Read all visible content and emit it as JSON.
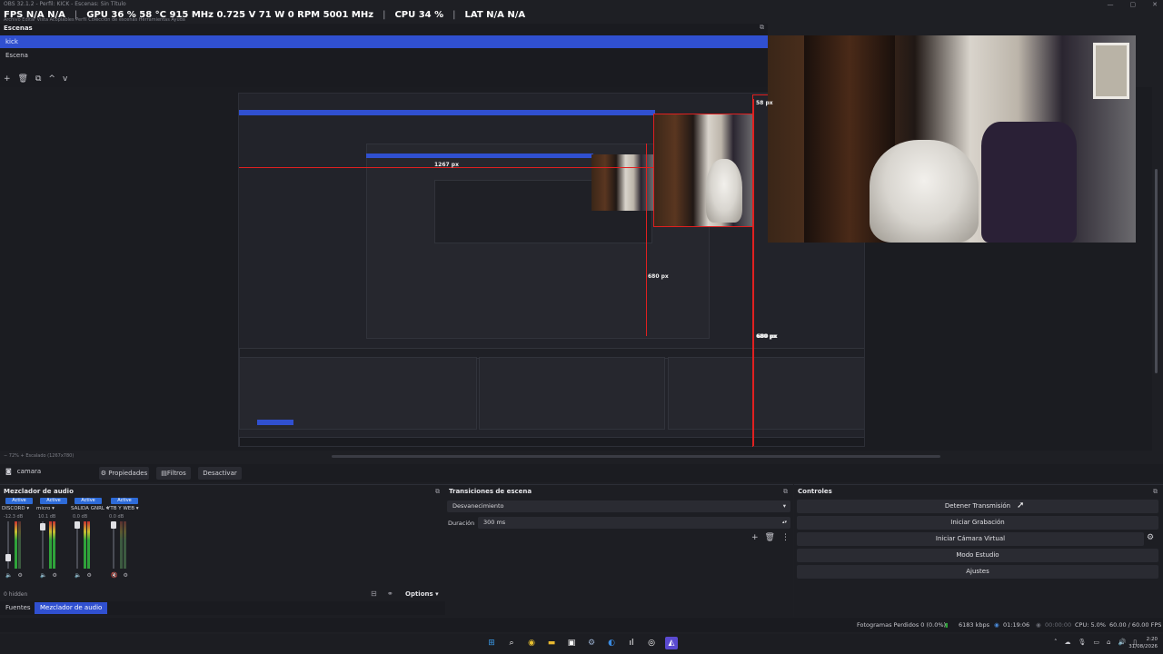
{
  "window": {
    "title": "OBS 32.1.2 - Perfil: KICK - Escenas: Sin Título",
    "menu": "Archivo  Editar  Vista  Acoplables  Perfil  Colección de escenas  Herramientas  Ayuda"
  },
  "stats": {
    "fps": "FPS N/A N/A",
    "gpu": "GPU 36 % 58 °C 915 MHz 0.725 V 71 W 0 RPM 5001 MHz",
    "cpu": "CPU 34 %",
    "lat": "LAT N/A N/A"
  },
  "scenes": {
    "title": "Escenas",
    "items": [
      "kick",
      "Escena"
    ],
    "tools": [
      "+",
      "🗑",
      "⧉",
      "^",
      "v"
    ]
  },
  "preview": {
    "label_width": "1267 px",
    "label_height_top": "58 px",
    "label_height_bottom": "680 px",
    "inner_label_mid": "680 px",
    "zoom": "72%",
    "scale": "Escalado (1267x780)"
  },
  "source_bar": {
    "source": "camara",
    "properties": "Propiedades",
    "filters": "Filtros",
    "deactivate": "Desactivar"
  },
  "mixer": {
    "title": "Mezclador de audio",
    "channels": [
      {
        "active": "Active",
        "name": "DISCORD",
        "db": "-12.3 dB"
      },
      {
        "active": "Active",
        "name": "micro",
        "db": "10.1 dB"
      },
      {
        "active": "Active",
        "name": "SALIDA GNRL",
        "db": "0.0 dB"
      },
      {
        "active": "Active",
        "name": "YTB Y WEB",
        "db": "0.0 dB"
      }
    ],
    "hidden": "0 hidden",
    "options": "Options"
  },
  "tabs": {
    "sources": "Fuentes",
    "mixer": "Mezclador de audio"
  },
  "transitions": {
    "title": "Transiciones de escena",
    "selected": "Desvanecimiento",
    "duration_label": "Duración",
    "duration_value": "300 ms"
  },
  "controls": {
    "title": "Controles",
    "stop_stream": "Detener Transmisión",
    "start_record": "Iniciar Grabación",
    "start_vcam": "Iniciar Cámara Virtual",
    "studio_mode": "Modo Estudio",
    "settings": "Ajustes"
  },
  "status": {
    "dropped": "Fotogramas Perdidos 0 (0.0%)",
    "bitrate": "6183 kbps",
    "stream_time": "01:19:06",
    "rec_time": "00:00:00",
    "cpu": "CPU: 5.0%",
    "fps": "60.00 / 60.00 FPS"
  },
  "taskbar": {
    "time": "2:20",
    "date": "31/08/2026"
  },
  "colors": {
    "accent": "#3050d0",
    "measure": "#e02020",
    "meter_green": "#2fa33a"
  }
}
